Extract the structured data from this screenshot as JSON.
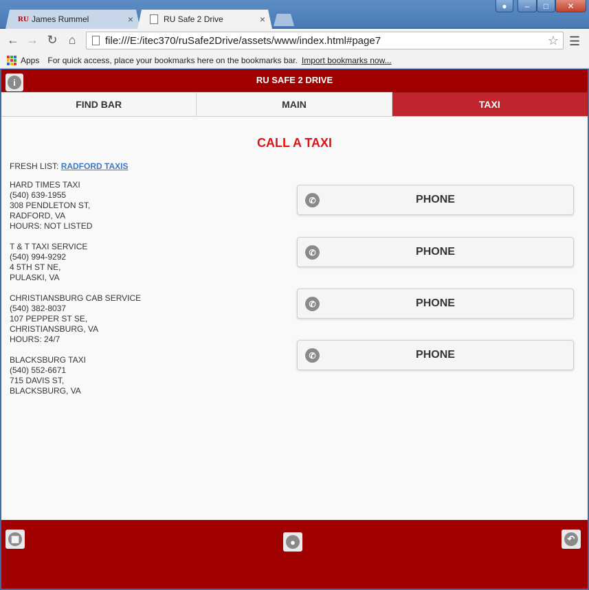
{
  "browser": {
    "tabs": [
      {
        "favicon": "RU",
        "label": "James Rummel",
        "close": "×"
      },
      {
        "favicon": "page-icon",
        "label": "RU Safe 2 Drive",
        "close": "×"
      }
    ],
    "window_controls": {
      "minimize": "–",
      "maximize": "□",
      "close": "✕"
    },
    "url": "file:///E:/itec370/ruSafe2Drive/assets/www/index.html#page7",
    "bookmarks": {
      "apps_label": "Apps",
      "message": "For quick access, place your bookmarks here on the bookmarks bar.",
      "import_link": "Import bookmarks now..."
    }
  },
  "app": {
    "header_title": "RU SAFE 2 DRIVE",
    "nav": [
      {
        "label": "FIND BAR",
        "active": false
      },
      {
        "label": "MAIN",
        "active": false
      },
      {
        "label": "TAXI",
        "active": true
      }
    ],
    "page_title": "CALL A TAXI",
    "fresh_list_prefix": "FRESH LIST: ",
    "fresh_list_link": "RADFORD TAXIS",
    "listings": [
      {
        "lines": [
          "HARD TIMES TAXI",
          "(540) 639-1955",
          "308 PENDLETON ST,",
          "RADFORD, VA",
          "HOURS: NOT LISTED"
        ],
        "button": "PHONE"
      },
      {
        "lines": [
          "T & T TAXI SERVICE",
          "(540) 994-9292",
          "4 5TH ST NE,",
          "PULASKI, VA"
        ],
        "button": "PHONE"
      },
      {
        "lines": [
          "CHRISTIANSBURG CAB SERVICE",
          "(540) 382-8037",
          "107 PEPPER ST SE,",
          "CHRISTIANSBURG, VA",
          "HOURS: 24/7"
        ],
        "button": "PHONE"
      },
      {
        "lines": [
          "BLACKSBURG TAXI",
          "(540) 552-6671",
          "715 DAVIS ST,",
          "BLACKSBURG, VA"
        ],
        "button": "PHONE"
      }
    ],
    "colors": {
      "brand_red": "#a00000",
      "active_tab": "#c0242c",
      "title_red": "#e31212",
      "link_blue": "#3a78c6"
    }
  }
}
